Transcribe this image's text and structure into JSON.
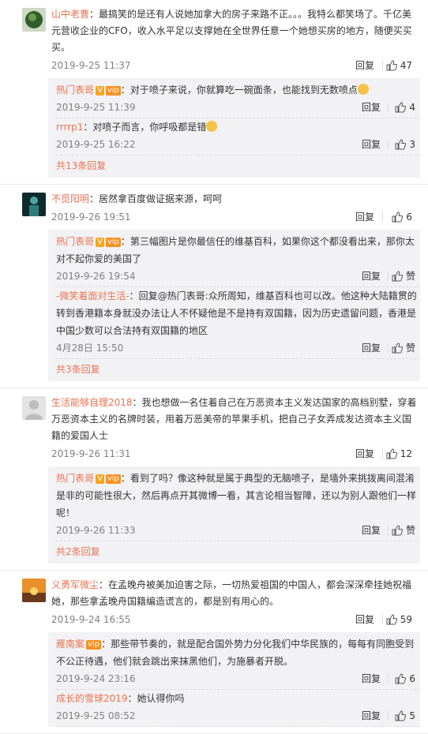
{
  "ui": {
    "reply": "回复",
    "like_text": "赞"
  },
  "colors": {
    "username": "#eb7350",
    "badge_v": "#f6a41b",
    "badge_vip": "#f78f21",
    "meta": "#808080",
    "subs_bg": "#f2f2f5"
  },
  "comments": [
    {
      "user": "山中老曹",
      "text": "：最搞笑的是还有人说她加拿大的房子来路不正。。。我特么都笑场了。千亿美元营收企业的CFO，收入水平足以支撑她在全世界任意一个她想买房的地方，随便买买买。",
      "time": "2019-9-25 11:37",
      "likes": "47",
      "avatar": "avatar-green-circle",
      "subs": [
        {
          "user": "热门表哥",
          "badges": [
            "V",
            "vip"
          ],
          "text": "：对于喷子来说，你就算吃一碗面条，也能找到无数喷点",
          "emoji": true,
          "time": "2019-9-25 11:39",
          "likes": "4"
        },
        {
          "user": "rrrrp1",
          "badges": [],
          "text": "：对喷子而言，你呼吸都是错",
          "emoji": true,
          "time": "2019-9-25 16:22",
          "likes": "3"
        }
      ],
      "more": "共13条回复"
    },
    {
      "user": "不觅阳明",
      "text": "：居然拿百度做证据来源，呵呵",
      "time": "2019-9-26 19:51",
      "likes": "6",
      "avatar": "avatar-dark-figure",
      "subs": [
        {
          "user": "热门表哥",
          "badges": [
            "V",
            "vip"
          ],
          "text": "：第三幅图片是你最信任的维基百科，如果你这个都没看出来，那你太对不起你爱的美国了",
          "emoji": false,
          "time": "2019-9-26 19:54",
          "likes": "赞"
        },
        {
          "user": "-微笑着面对生活-",
          "badges": [],
          "text": "：回复@热门表哥:众所周知，维基百科也可以改。他这种大陆籍贯的转到香港籍本身就没办法让人不怀疑他是不是持有双国籍，因为历史遗留问题，香港是中国少数可以合法持有双国籍的地区",
          "emoji": false,
          "time": "4月28日 15:50",
          "likes": "赞"
        }
      ],
      "more": "共3条回复"
    },
    {
      "user": "生活能够自理2018",
      "text": "：我也想做一名住着自己在万恶资本主义发达国家的高档别墅，穿着万恶资本主义的名牌时装，用着万恶美帝的苹果手机，把自己子女弄成发达资本主义国籍的爱国人士",
      "time": "2019-9-26 11:31",
      "likes": "12",
      "avatar": "avatar-default",
      "subs": [
        {
          "user": "热门表哥",
          "badges": [
            "V",
            "vip"
          ],
          "text": "：看到了吗？像这种就是属于典型的无脑喷子，是墙外来挑拨离间混淆是非的可能性很大，然后再点开其微博一看，其言论相当智障，还以为别人跟他们一样呢！",
          "emoji": false,
          "time": "2019-9-26 11:33",
          "likes": "赞"
        }
      ],
      "more": "共2条回复"
    },
    {
      "user": "义勇军微尘",
      "text": "：在孟晚舟被美加迫害之际，一切热爱祖国的中国人，都会深深牵挂她祝福她，那些拿孟晚舟国籍编造谎言的，都是别有用心的。",
      "time": "2019-9-24 16:55",
      "likes": "59",
      "avatar": "avatar-sunset",
      "subs": [
        {
          "user": "雁南案",
          "badges": [
            "vip"
          ],
          "text": "：那些带节奏的，就是配合国外势力分化我们中华民族的，每每有同胞受到不公正待遇，他们就会跳出来抹黑他们，为施暴者开脱。",
          "emoji": false,
          "time": "2019-9-24 23:16",
          "likes": "6"
        },
        {
          "user": "成长的雪球2019",
          "badges": [],
          "text": "：她认得你吗",
          "emoji": false,
          "time": "2019-9-25 08:52",
          "likes": "5"
        }
      ],
      "more": ""
    }
  ]
}
